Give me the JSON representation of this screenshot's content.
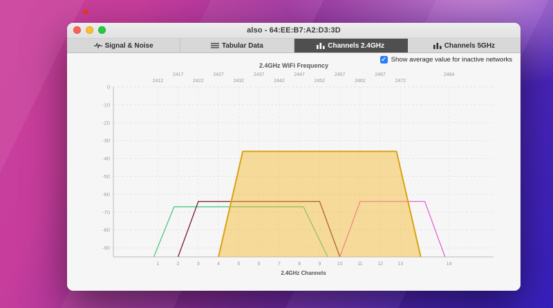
{
  "colors": {
    "accent_blue": "#2a7cf7",
    "traffic_red": "#ff5f57",
    "traffic_yellow": "#febc2e",
    "traffic_green": "#28c840",
    "tab_selected_bg": "#4f4f4f",
    "desktop_dot": "#e8392b"
  },
  "window": {
    "title": "also - 64:EE:B7:A2:D3:3D",
    "tabs": [
      {
        "label": "Signal & Noise",
        "icon": "waveform-icon",
        "selected": false
      },
      {
        "label": "Tabular Data",
        "icon": "list-icon",
        "selected": false
      },
      {
        "label": "Channels 2.4GHz",
        "icon": "bar-chart-icon",
        "selected": true
      },
      {
        "label": "Channels 5GHz",
        "icon": "bar-chart-icon",
        "selected": false
      }
    ],
    "checkbox": {
      "label": "Show average value for inactive networks",
      "checked": true,
      "check_glyph": "✓"
    }
  },
  "chart_data": {
    "type": "area",
    "title": "2.4GHz WiFi Frequency",
    "xlabel": "2.4GHz Channels",
    "ylabel": "",
    "grid": true,
    "xlim_mhz": [
      2401,
      2495
    ],
    "ylim": [
      -95,
      0
    ],
    "y_ticks_dbm": [
      0,
      -10,
      -20,
      -30,
      -40,
      -50,
      -60,
      -70,
      -80,
      -90
    ],
    "frequencies_mhz": [
      2412,
      2417,
      2422,
      2427,
      2432,
      2437,
      2442,
      2447,
      2452,
      2457,
      2462,
      2467,
      2472,
      2484
    ],
    "channels": [
      1,
      2,
      3,
      4,
      5,
      6,
      7,
      8,
      9,
      10,
      11,
      12,
      13,
      14
    ],
    "networks": [
      {
        "id": "green",
        "stroke": "#3ec57a",
        "fill": "none",
        "stroke_width": 1.2,
        "base_mhz": [
          2411,
          2454
        ],
        "top_mhz": [
          2416,
          2448
        ],
        "peak_dbm": -67
      },
      {
        "id": "dark-red",
        "stroke": "#7e2837",
        "fill": "none",
        "stroke_width": 1.4,
        "base_mhz": [
          2417,
          2457
        ],
        "top_mhz": [
          2422,
          2452
        ],
        "peak_dbm": -64
      },
      {
        "id": "magenta",
        "stroke": "#df59cf",
        "fill": "none",
        "stroke_width": 1.2,
        "base_mhz": [
          2457,
          2483
        ],
        "top_mhz": [
          2462,
          2478
        ],
        "peak_dbm": -64
      },
      {
        "id": "orange",
        "stroke": "#d9a213",
        "fill": "rgba(247,183,42,0.45)",
        "stroke_width": 2,
        "base_mhz": [
          2427,
          2477
        ],
        "top_mhz": [
          2433,
          2471
        ],
        "peak_dbm": -36
      }
    ]
  }
}
